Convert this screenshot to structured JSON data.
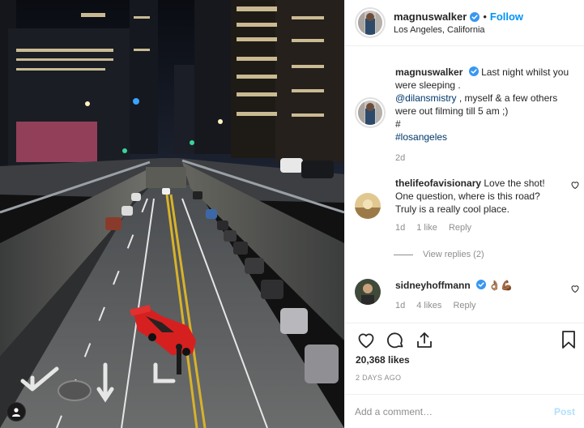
{
  "photo": {
    "alt_icon": "user-tag-icon"
  },
  "post": {
    "author": "magnuswalker",
    "follow_label": "Follow",
    "location": "Los Angeles, California",
    "caption": {
      "author": "magnuswalker",
      "text_1": "Last night whilst you were sleeping .",
      "mention": "@dilansmistry",
      "text_2": ", myself & a few others were out filming till 5 am ;)",
      "hash_line": "#",
      "hashtag": "#losangeles",
      "time": "2d"
    },
    "comments": [
      {
        "author": "thelifeofavisionary",
        "text": "Love the shot! One question, where is this road? Truly is a really cool place.",
        "time": "1d",
        "likes": "1 like",
        "reply": "Reply"
      },
      {
        "author": "sidneyhoffmann",
        "text": "👌🏽💪🏾",
        "time": "1d",
        "likes": "4 likes",
        "reply": "Reply"
      }
    ],
    "view_replies": "View replies (2)",
    "likes_count": "20,368 likes",
    "posted_at": "2 DAYS AGO",
    "comment_placeholder": "Add a comment…",
    "post_label": "Post"
  },
  "colors": {
    "accent": "#0095f6",
    "link": "#00376b",
    "muted": "#8e8e8e",
    "post_disabled": "#b2dffc"
  }
}
